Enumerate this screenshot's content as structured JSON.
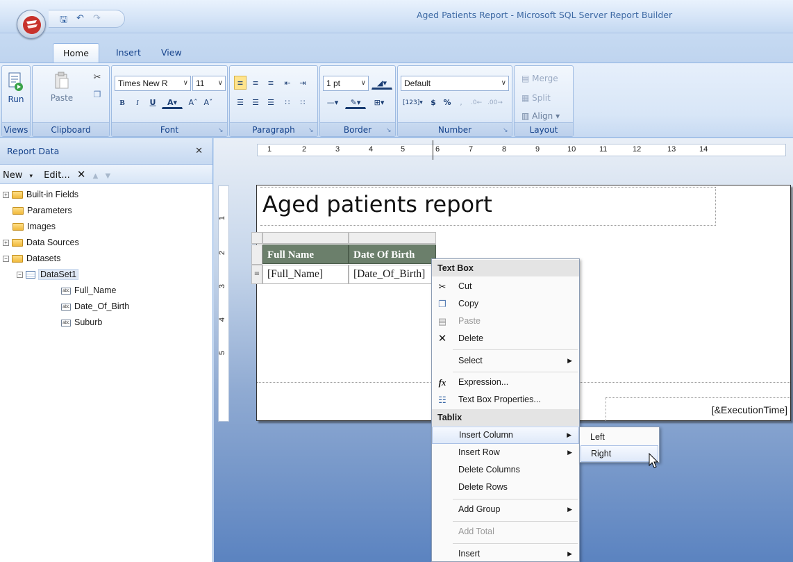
{
  "window": {
    "title": "Aged Patients Report - Microsoft SQL Server Report Builder"
  },
  "tabs": [
    {
      "label": "Home",
      "active": true
    },
    {
      "label": "Insert",
      "active": false
    },
    {
      "label": "View",
      "active": false
    }
  ],
  "ribbon": {
    "views": {
      "label": "Views",
      "run_label": "Run"
    },
    "clipboard": {
      "label": "Clipboard",
      "paste_label": "Paste"
    },
    "font": {
      "label": "Font",
      "family": "Times New R",
      "size": "11"
    },
    "paragraph": {
      "label": "Paragraph"
    },
    "border": {
      "label": "Border",
      "width": "1 pt"
    },
    "number": {
      "label": "Number",
      "format": "Default"
    },
    "layout": {
      "label": "Layout",
      "merge": "Merge",
      "split": "Split",
      "align": "Align"
    }
  },
  "report_data_pane": {
    "title": "Report Data",
    "new_label": "New",
    "edit_label": "Edit...",
    "tree": [
      {
        "label": "Built-in Fields"
      },
      {
        "label": "Parameters"
      },
      {
        "label": "Images"
      },
      {
        "label": "Data Sources"
      },
      {
        "label": "Datasets"
      },
      {
        "label": "DataSet1"
      },
      {
        "label": "Full_Name"
      },
      {
        "label": "Date_Of_Birth"
      },
      {
        "label": "Suburb"
      }
    ]
  },
  "ruler": {
    "horizontal": [
      "1",
      "2",
      "3",
      "4",
      "5",
      "6",
      "7",
      "8",
      "9",
      "10",
      "11",
      "12",
      "13",
      "14"
    ],
    "vertical": [
      "1",
      "2",
      "3",
      "4",
      "5"
    ]
  },
  "report": {
    "title": "Aged patients report",
    "table": {
      "headers": [
        "Full Name",
        "Date Of Birth"
      ],
      "row": [
        "[Full_Name]",
        "[Date_Of_Birth]"
      ]
    },
    "footer_value": "[&ExecutionTime]"
  },
  "context_menu": {
    "section_textbox": "Text Box",
    "cut": "Cut",
    "copy": "Copy",
    "paste": "Paste",
    "delete": "Delete",
    "select": "Select",
    "expression": "Expression...",
    "textbox_properties": "Text Box Properties...",
    "section_tablix": "Tablix",
    "insert_column": "Insert Column",
    "insert_row": "Insert Row",
    "delete_columns": "Delete Columns",
    "delete_rows": "Delete Rows",
    "add_group": "Add Group",
    "add_total": "Add Total",
    "insert": "Insert"
  },
  "submenu": {
    "left": "Left",
    "right": "Right"
  }
}
